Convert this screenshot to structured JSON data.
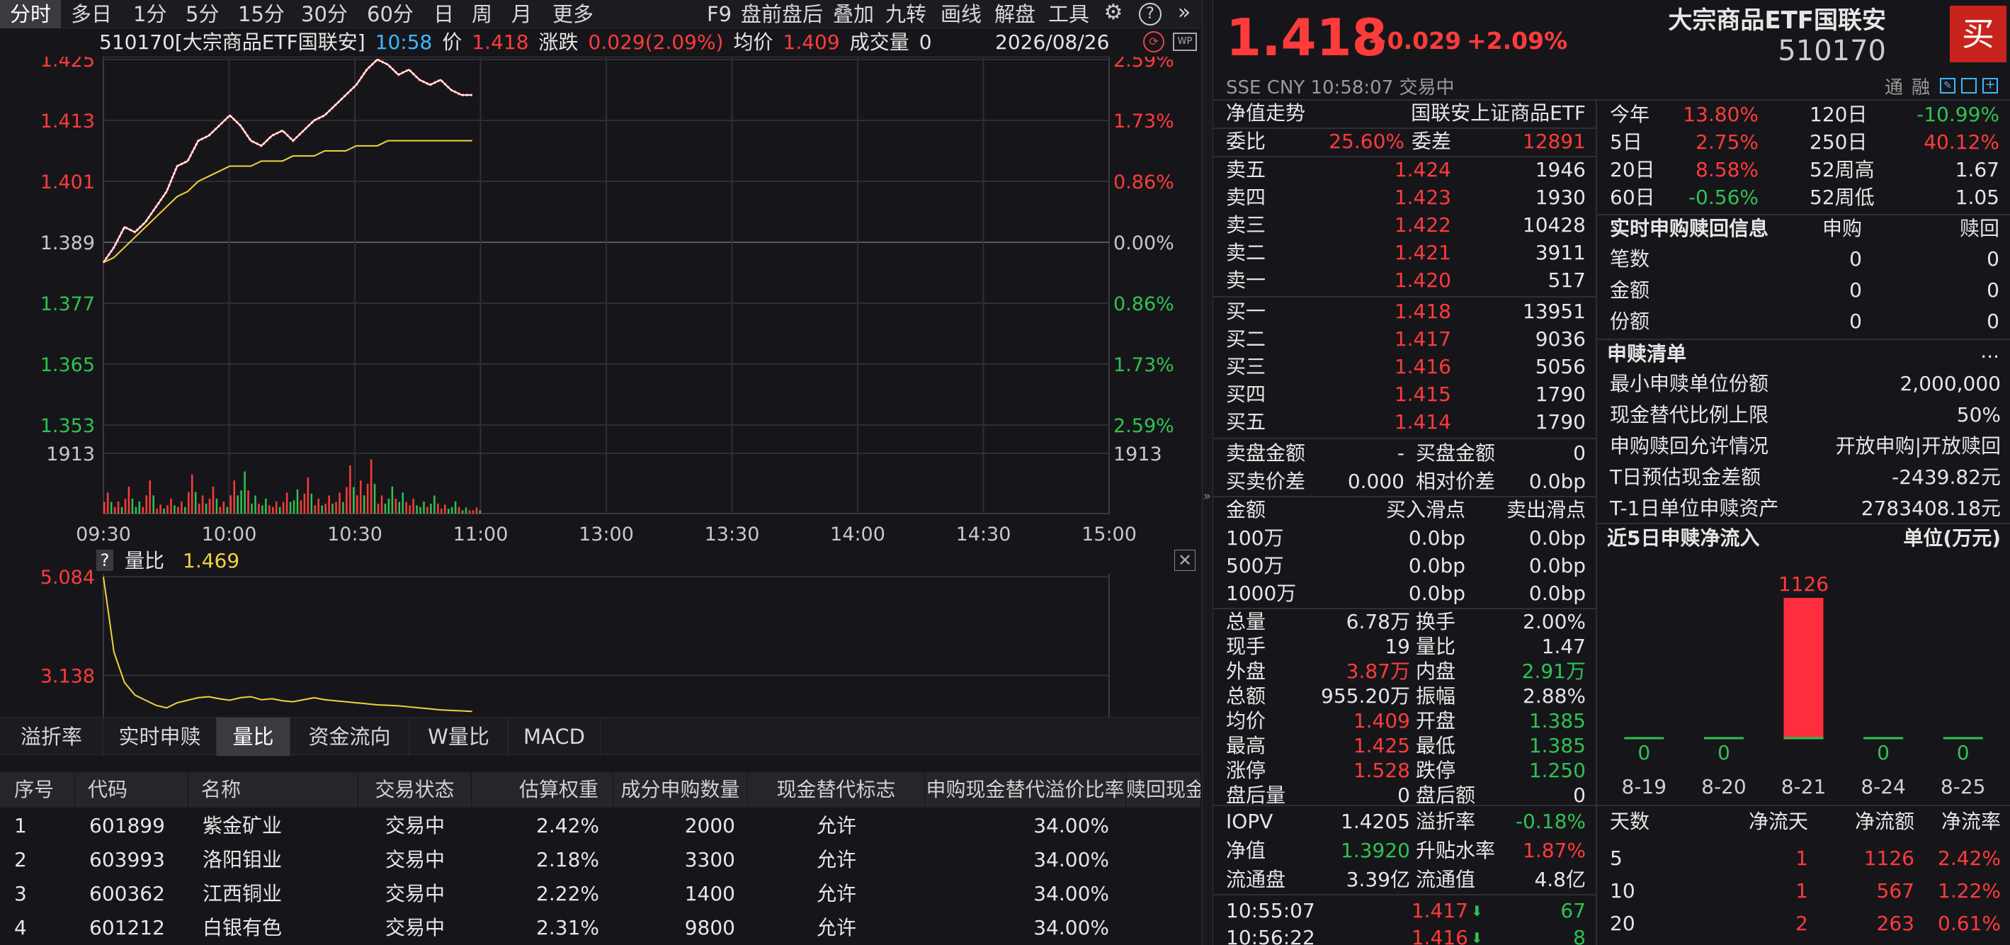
{
  "toolbar": {
    "periods": [
      "分时",
      "多日",
      "1分",
      "5分",
      "15分",
      "30分",
      "60分",
      "日",
      "周",
      "月",
      "更多"
    ],
    "tools": [
      "F9",
      "盘前盘后",
      "叠加",
      "九转",
      "画线",
      "解盘",
      "工具"
    ]
  },
  "chart_info": {
    "title": "510170[大宗商品ETF国联安]",
    "time": "10:58",
    "price_label": "价",
    "price": "1.418",
    "change_label": "涨跌",
    "change": "0.029(2.09%)",
    "avg_label": "均价",
    "avg": "1.409",
    "vol_label": "成交量",
    "vol": "0",
    "date": "2026/08/26"
  },
  "chart_data": [
    {
      "type": "line",
      "name": "intraday-price",
      "y_ticks_left": [
        "1.425",
        "1.413",
        "1.401",
        "1.389",
        "1.377",
        "1.365",
        "1.353"
      ],
      "y_ticks_right": [
        "2.59%",
        "1.73%",
        "0.86%",
        "0.00%",
        "0.86%",
        "1.73%",
        "2.59%"
      ],
      "volume_tick": "1913",
      "x_ticks": [
        "09:30",
        "10:00",
        "10:30",
        "11:00",
        "13:00",
        "13:30",
        "14:00",
        "14:30",
        "15:00"
      ],
      "ylim": [
        1.353,
        1.425
      ],
      "prev_close": 1.389,
      "series": [
        {
          "values": [
            1.385,
            1.388,
            1.392,
            1.391,
            1.393,
            1.396,
            1.399,
            1.404,
            1.405,
            1.409,
            1.41,
            1.412,
            1.414,
            1.412,
            1.409,
            1.408,
            1.41,
            1.411,
            1.409,
            1.411,
            1.413,
            1.414,
            1.416,
            1.418,
            1.42,
            1.423,
            1.425,
            1.424,
            1.422,
            1.423,
            1.421,
            1.42,
            1.421,
            1.419,
            1.418,
            1.418
          ]
        },
        {
          "values": [
            1.385,
            1.386,
            1.388,
            1.39,
            1.392,
            1.394,
            1.396,
            1.398,
            1.399,
            1.401,
            1.402,
            1.403,
            1.404,
            1.404,
            1.404,
            1.405,
            1.405,
            1.405,
            1.406,
            1.406,
            1.406,
            1.407,
            1.407,
            1.407,
            1.408,
            1.408,
            1.408,
            1.409,
            1.409,
            1.409,
            1.409,
            1.409,
            1.409,
            1.409,
            1.409,
            1.409
          ]
        }
      ],
      "volumes": [
        0.35,
        0.2,
        0.45,
        0.2,
        0.55,
        0.15,
        0.25,
        0.2,
        0.65,
        0.3,
        0.45,
        0.2,
        0.55,
        0.7,
        0.3,
        0.25,
        0.2,
        0.35,
        0.4,
        0.6,
        0.25,
        0.3,
        0.35,
        0.8,
        0.55,
        0.9,
        0.3,
        0.45,
        0.35,
        0.25,
        0.2,
        0.3,
        0.15,
        0.2,
        0.1,
        0.1
      ]
    },
    {
      "type": "line",
      "name": "volume-ratio",
      "label": "量比",
      "value": "1.469",
      "y_ticks": [
        "5.084",
        "3.138"
      ],
      "series": [
        {
          "values": [
            5.08,
            3.6,
            3.0,
            2.75,
            2.65,
            2.55,
            2.5,
            2.6,
            2.65,
            2.7,
            2.72,
            2.68,
            2.65,
            2.7,
            2.72,
            2.66,
            2.68,
            2.64,
            2.62,
            2.66,
            2.7,
            2.66,
            2.64,
            2.62,
            2.6,
            2.58,
            2.56,
            2.55,
            2.54,
            2.52,
            2.5,
            2.48,
            2.46,
            2.45,
            2.44,
            2.43
          ]
        }
      ]
    }
  ],
  "tabs": [
    "溢折率",
    "实时申赎",
    "量比",
    "资金流向",
    "W量比",
    "MACD"
  ],
  "table": {
    "headers": [
      "序号",
      "代码",
      "名称",
      "交易状态",
      "估算权重",
      "成分申购数量",
      "现金替代标志",
      "申购现金替代溢价比率",
      "赎回现金"
    ],
    "rows": [
      [
        "1",
        "601899",
        "紫金矿业",
        "交易中",
        "2.42%",
        "2000",
        "允许",
        "34.00%"
      ],
      [
        "2",
        "603993",
        "洛阳钼业",
        "交易中",
        "2.18%",
        "3300",
        "允许",
        "34.00%"
      ],
      [
        "3",
        "600362",
        "江西铜业",
        "交易中",
        "2.22%",
        "1400",
        "允许",
        "34.00%"
      ],
      [
        "4",
        "601212",
        "白银有色",
        "交易中",
        "2.31%",
        "9800",
        "允许",
        "34.00%"
      ]
    ]
  },
  "quote": {
    "price": "1.418",
    "change": "+0.029",
    "pct": "+2.09%",
    "name": "大宗商品ETF国联安",
    "code": "510170",
    "buy": "买",
    "market": "SSE",
    "currency": "CNY",
    "time": "10:58:07",
    "status": "交易中",
    "tong": "通",
    "rong": "融"
  },
  "nav": {
    "label": "净值走势",
    "index": "国联安上证商品ETF"
  },
  "weibi": {
    "l1": "委比",
    "v1": "25.60%",
    "l2": "委差",
    "v2": "12891"
  },
  "asks": [
    [
      "卖五",
      "1.424",
      "1946"
    ],
    [
      "卖四",
      "1.423",
      "1930"
    ],
    [
      "卖三",
      "1.422",
      "10428"
    ],
    [
      "卖二",
      "1.421",
      "3911"
    ],
    [
      "卖一",
      "1.420",
      "517"
    ]
  ],
  "bids": [
    [
      "买一",
      "1.418",
      "13951"
    ],
    [
      "买二",
      "1.417",
      "9036"
    ],
    [
      "买三",
      "1.416",
      "5056"
    ],
    [
      "买四",
      "1.415",
      "1790"
    ],
    [
      "买五",
      "1.414",
      "1790"
    ]
  ],
  "amounts": {
    "sell_amt_l": "卖盘金额",
    "sell_amt_v": "-",
    "buy_amt_l": "买盘金额",
    "buy_amt_v": "0",
    "spread_l": "买卖价差",
    "spread_v": "0.000",
    "rel_l": "相对价差",
    "rel_v": "0.0bp"
  },
  "slip": {
    "h1": "金额",
    "h2": "买入滑点",
    "h3": "卖出滑点",
    "rows": [
      [
        "100万",
        "0.0bp",
        "0.0bp"
      ],
      [
        "500万",
        "0.0bp",
        "0.0bp"
      ],
      [
        "1000万",
        "0.0bp",
        "0.0bp"
      ]
    ]
  },
  "stats": [
    [
      "总量",
      "6.78万",
      "换手",
      "2.00%"
    ],
    [
      "现手",
      "19",
      "量比",
      "1.47"
    ],
    [
      "外盘",
      "3.87万",
      "内盘",
      "2.91万"
    ],
    [
      "总额",
      "955.20万",
      "振幅",
      "2.88%"
    ],
    [
      "均价",
      "1.409",
      "开盘",
      "1.385"
    ],
    [
      "最高",
      "1.425",
      "最低",
      "1.385"
    ],
    [
      "涨停",
      "1.528",
      "跌停",
      "1.250"
    ],
    [
      "盘后量",
      "0",
      "盘后额",
      "0"
    ]
  ],
  "iopv": [
    [
      "IOPV",
      "1.4205",
      "溢折率",
      "-0.18%"
    ],
    [
      "净值",
      "1.3920",
      "升贴水率",
      "1.87%"
    ],
    [
      "流通盘",
      "3.39亿",
      "流通值",
      "4.8亿"
    ]
  ],
  "ticks": [
    [
      "10:55:07",
      "1.417",
      "67"
    ],
    [
      "10:56:22",
      "1.416",
      "8"
    ]
  ],
  "perf": [
    [
      "今年",
      "13.80%",
      "120日",
      "-10.99%"
    ],
    [
      "5日",
      "2.75%",
      "250日",
      "40.12%"
    ],
    [
      "20日",
      "8.58%",
      "52周高",
      "1.67"
    ],
    [
      "60日",
      "-0.56%",
      "52周低",
      "1.05"
    ]
  ],
  "realtime": {
    "title": "实时申购赎回信息",
    "h1": "申购",
    "h2": "赎回",
    "rows": [
      [
        "笔数",
        "0",
        "0"
      ],
      [
        "金额",
        "0",
        "0"
      ],
      [
        "份额",
        "0",
        "0"
      ]
    ]
  },
  "list": {
    "title": "申赎清单",
    "more": "...",
    "rows": [
      [
        "最小申赎单位份额",
        "2,000,000"
      ],
      [
        "现金替代比例上限",
        "50%"
      ],
      [
        "申购赎回允许情况",
        "开放申购|开放赎回"
      ],
      [
        "T日预估现金差额",
        "-2439.82元"
      ],
      [
        "T-1日单位申赎资产",
        "2783408.18元"
      ]
    ]
  },
  "flow": {
    "title": "近5日申赎净流入",
    "unit": "单位(万元)",
    "labels": [
      "8-19",
      "8-20",
      "8-21",
      "8-24",
      "8-25"
    ],
    "values": [
      0,
      0,
      1126,
      0,
      0
    ],
    "value_labels": [
      "0",
      "0",
      "1126",
      "0",
      "0"
    ]
  },
  "netflow": {
    "headers": [
      "天数",
      "净流天",
      "净流额",
      "净流率"
    ],
    "rows": [
      [
        "5",
        "1",
        "1126",
        "2.42%"
      ],
      [
        "10",
        "1",
        "567",
        "1.22%"
      ],
      [
        "20",
        "2",
        "263",
        "0.61%"
      ]
    ]
  },
  "colors": {
    "up": "#ff3b3b",
    "down": "#2fc252",
    "avg": "#f3d23c",
    "bg": "#16161a"
  }
}
